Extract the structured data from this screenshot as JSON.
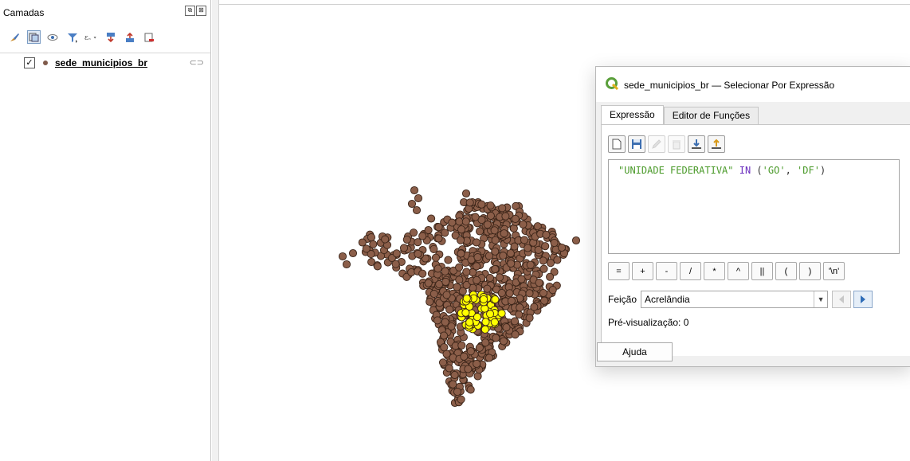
{
  "layers_panel": {
    "title": "Camadas",
    "header_buttons": [
      "⧉",
      "⊠"
    ],
    "toolbar_icons": [
      "style-manager-icon",
      "add-group-icon",
      "visibility-icon",
      "filter-legend-icon",
      "filter-expression-icon",
      "expand-all-icon",
      "collapse-all-icon",
      "remove-layer-icon"
    ],
    "layers": [
      {
        "name": "sede_municipios_br",
        "checked": true,
        "check_mark": "✓",
        "point_color": "#7f5a4a",
        "extra_glyph": "⊂⊃"
      }
    ]
  },
  "map": {
    "point_color": "#8b5e49",
    "selected_color": "#ffff00",
    "point_stroke": "#3a2418"
  },
  "dialog": {
    "title": "sede_municipios_br — Selecionar Por Expressão",
    "tabs": [
      "Expressão",
      "Editor de Funções"
    ],
    "active_tab": "Expressão",
    "toolbar_icons": [
      "new-file-icon",
      "save-icon",
      "edit-icon",
      "delete-icon",
      "import-icon",
      "export-icon"
    ],
    "expression": {
      "field": "\"UNIDADE FEDERATIVA\"",
      "keyword": "IN",
      "open_paren": "(",
      "value1": "'GO'",
      "comma": ",",
      "value2": "'DF'",
      "close_paren": ")"
    },
    "operators": [
      "=",
      "+",
      "-",
      "/",
      "*",
      "^",
      "||",
      "(",
      ")",
      "'\\n'"
    ],
    "feature_label": "Feição",
    "feature_value": "Acrelândia",
    "preview_label": "Pré-visualização:",
    "preview_value": "0",
    "help_label": "Ajuda"
  }
}
